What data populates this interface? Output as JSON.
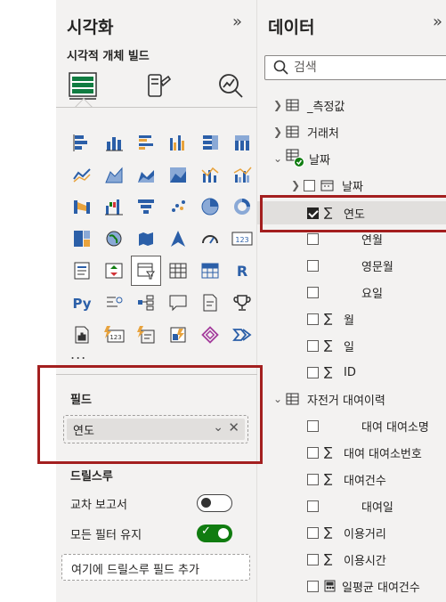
{
  "visualizations": {
    "title": "시각화",
    "collapse_icon": "»",
    "subtitle": "시각적 개체 빌드",
    "build_tabs": [
      "build-visual-icon",
      "format-visual-icon",
      "analytics-icon"
    ],
    "more": "...",
    "fields_label": "필드",
    "field_value": "연도",
    "drillthrough_label": "드릴스루",
    "cross_report_label": "교차 보고서",
    "cross_report_state": "off",
    "keep_filters_label": "모든 필터 유지",
    "keep_filters_state": "on",
    "add_drill_placeholder": "여기에 드릴스루 필드 추가"
  },
  "data_pane": {
    "title": "데이터",
    "collapse_icon": "»",
    "search_placeholder": "검색",
    "tables": [
      {
        "name": "_측정값",
        "expanded": false
      },
      {
        "name": "거래처",
        "expanded": false
      },
      {
        "name": "날짜",
        "expanded": true,
        "fields": [
          {
            "label": "날짜",
            "type": "date-hierarchy",
            "checked": false
          },
          {
            "label": "연도",
            "type": "sum",
            "checked": true
          },
          {
            "label": "연월",
            "type": "text",
            "checked": false
          },
          {
            "label": "영문월",
            "type": "text",
            "checked": false
          },
          {
            "label": "요일",
            "type": "text",
            "checked": false
          },
          {
            "label": "월",
            "type": "sum",
            "checked": false
          },
          {
            "label": "일",
            "type": "sum",
            "checked": false
          },
          {
            "label": "ID",
            "type": "sum",
            "checked": false
          }
        ]
      },
      {
        "name": "자전거 대여이력",
        "expanded": true,
        "fields": [
          {
            "label": "대여 대여소명",
            "type": "text",
            "checked": false
          },
          {
            "label": "대여 대여소번호",
            "type": "sum",
            "checked": false
          },
          {
            "label": "대여건수",
            "type": "sum",
            "checked": false
          },
          {
            "label": "대여일",
            "type": "text",
            "checked": false
          },
          {
            "label": "이용거리",
            "type": "sum",
            "checked": false
          },
          {
            "label": "이용시간",
            "type": "sum",
            "checked": false
          },
          {
            "label": "일평균 대여건수",
            "type": "measure",
            "checked": false
          }
        ]
      }
    ]
  },
  "colors": {
    "accent_red": "#a31f1f",
    "toggle_on": "#107c10",
    "pane_bg": "#f3f2f1"
  }
}
